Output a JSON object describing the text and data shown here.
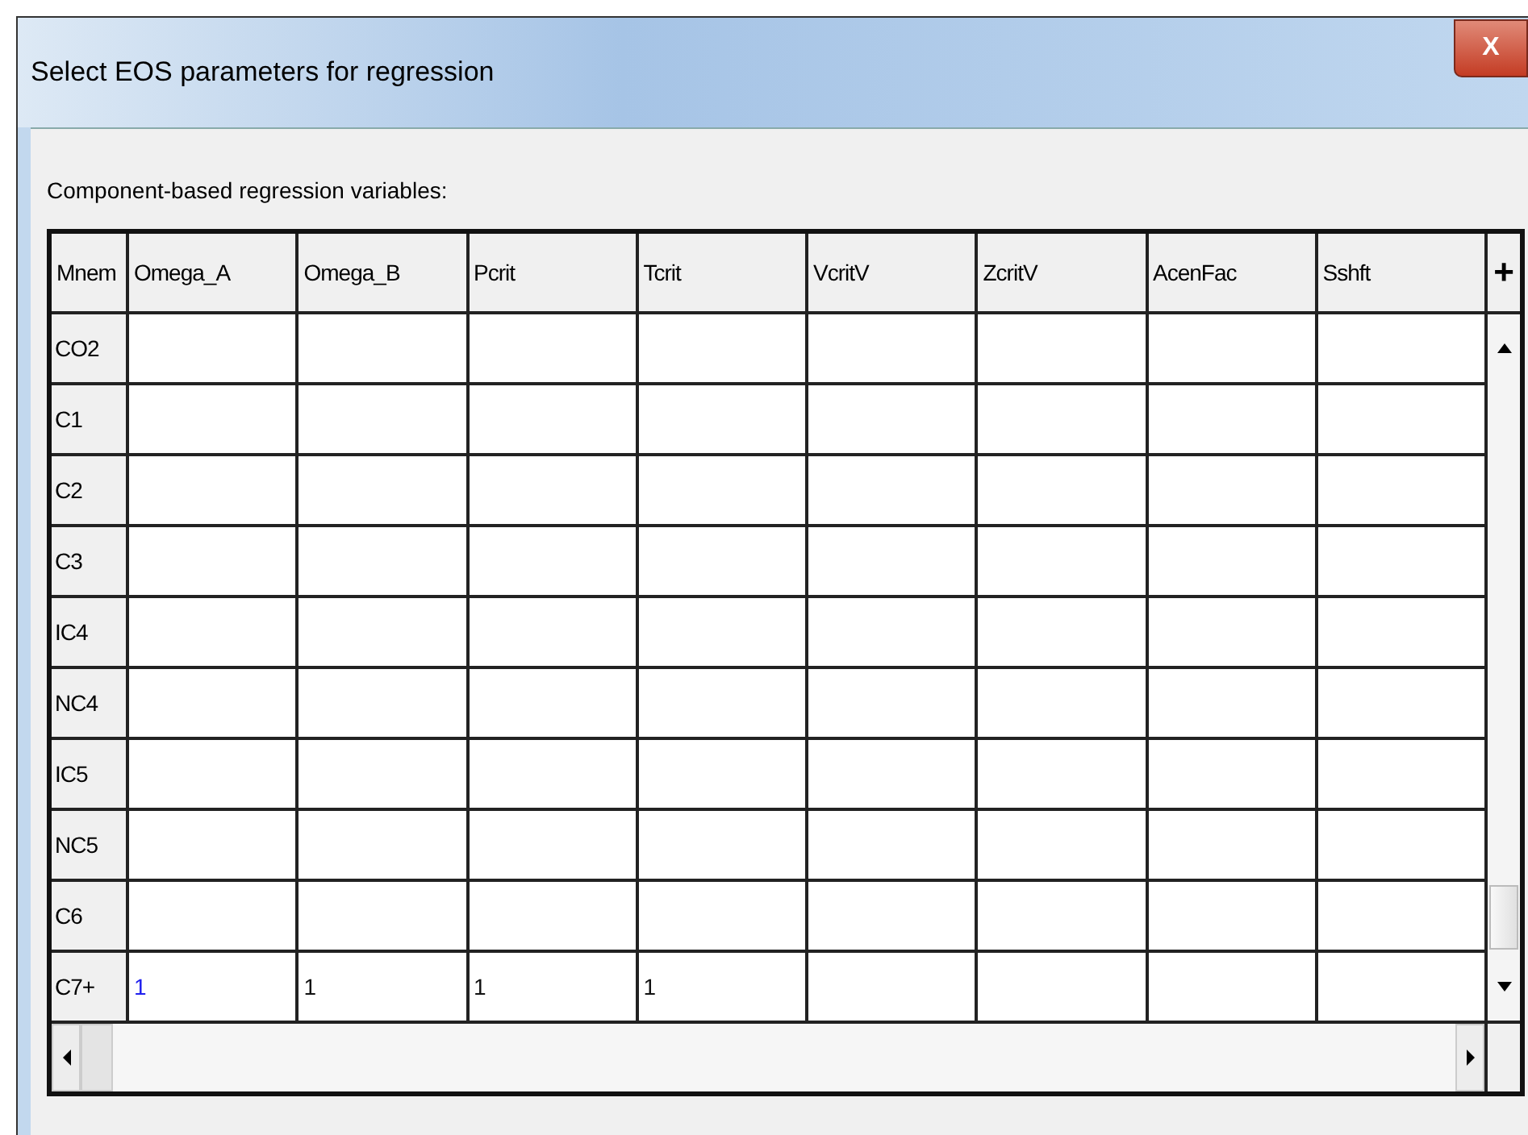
{
  "window": {
    "title": "Select EOS parameters for regression",
    "close": "X"
  },
  "section_label": "Component-based regression variables:",
  "table": {
    "columns": [
      "Mnem",
      "Omega_A",
      "Omega_B",
      "Pcrit",
      "Tcrit",
      "VcritV",
      "ZcritV",
      "AcenFac",
      "Sshft"
    ],
    "corner": "+",
    "rows": [
      {
        "cells": [
          "CO2",
          "",
          "",
          "",
          "",
          "",
          "",
          "",
          ""
        ]
      },
      {
        "cells": [
          "C1",
          "",
          "",
          "",
          "",
          "",
          "",
          "",
          ""
        ]
      },
      {
        "cells": [
          "C2",
          "",
          "",
          "",
          "",
          "",
          "",
          "",
          ""
        ]
      },
      {
        "cells": [
          "C3",
          "",
          "",
          "",
          "",
          "",
          "",
          "",
          ""
        ]
      },
      {
        "cells": [
          "IC4",
          "",
          "",
          "",
          "",
          "",
          "",
          "",
          ""
        ]
      },
      {
        "cells": [
          "NC4",
          "",
          "",
          "",
          "",
          "",
          "",
          "",
          ""
        ]
      },
      {
        "cells": [
          "IC5",
          "",
          "",
          "",
          "",
          "",
          "",
          "",
          ""
        ]
      },
      {
        "cells": [
          "NC5",
          "",
          "",
          "",
          "",
          "",
          "",
          "",
          ""
        ]
      },
      {
        "cells": [
          "C6",
          "",
          "",
          "",
          "",
          "",
          "",
          "",
          ""
        ]
      },
      {
        "cells": [
          "C7+",
          "1",
          "1",
          "1",
          "1",
          "",
          "",
          "",
          ""
        ]
      }
    ]
  }
}
